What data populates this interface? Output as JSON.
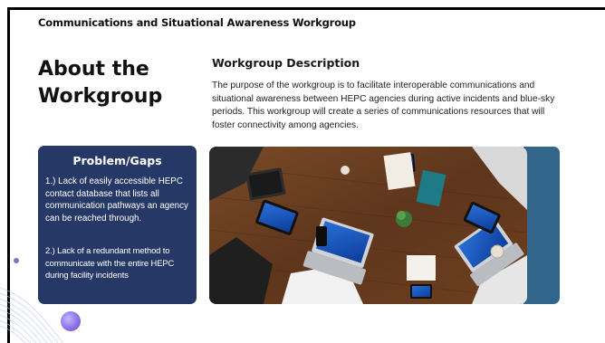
{
  "header": {
    "title": "Communications and Situational Awareness Workgroup"
  },
  "page": {
    "title": "About the Workgroup"
  },
  "description": {
    "heading": "Workgroup Description",
    "body": "The purpose of the workgroup is to facilitate interoperable communications and situational awareness between HEPC agencies during active incidents and blue-sky periods. This workgroup will create a series of communications resources that will foster connectivity among agencies."
  },
  "gaps": {
    "title": "Problem/Gaps",
    "items": [
      "1.) Lack of easily accessible HEPC contact database that lists all communication pathways an agency can be reached through.",
      "2.) Lack of a redundant method to communicate with the entire HEPC during facility incidents"
    ]
  },
  "colors": {
    "panel": "#263865",
    "accent_strip": "#31658a",
    "table_wood": "#6a3f22",
    "decor_purple": "#8c72e8"
  },
  "photo": {
    "icon": "team-meeting-photo"
  }
}
